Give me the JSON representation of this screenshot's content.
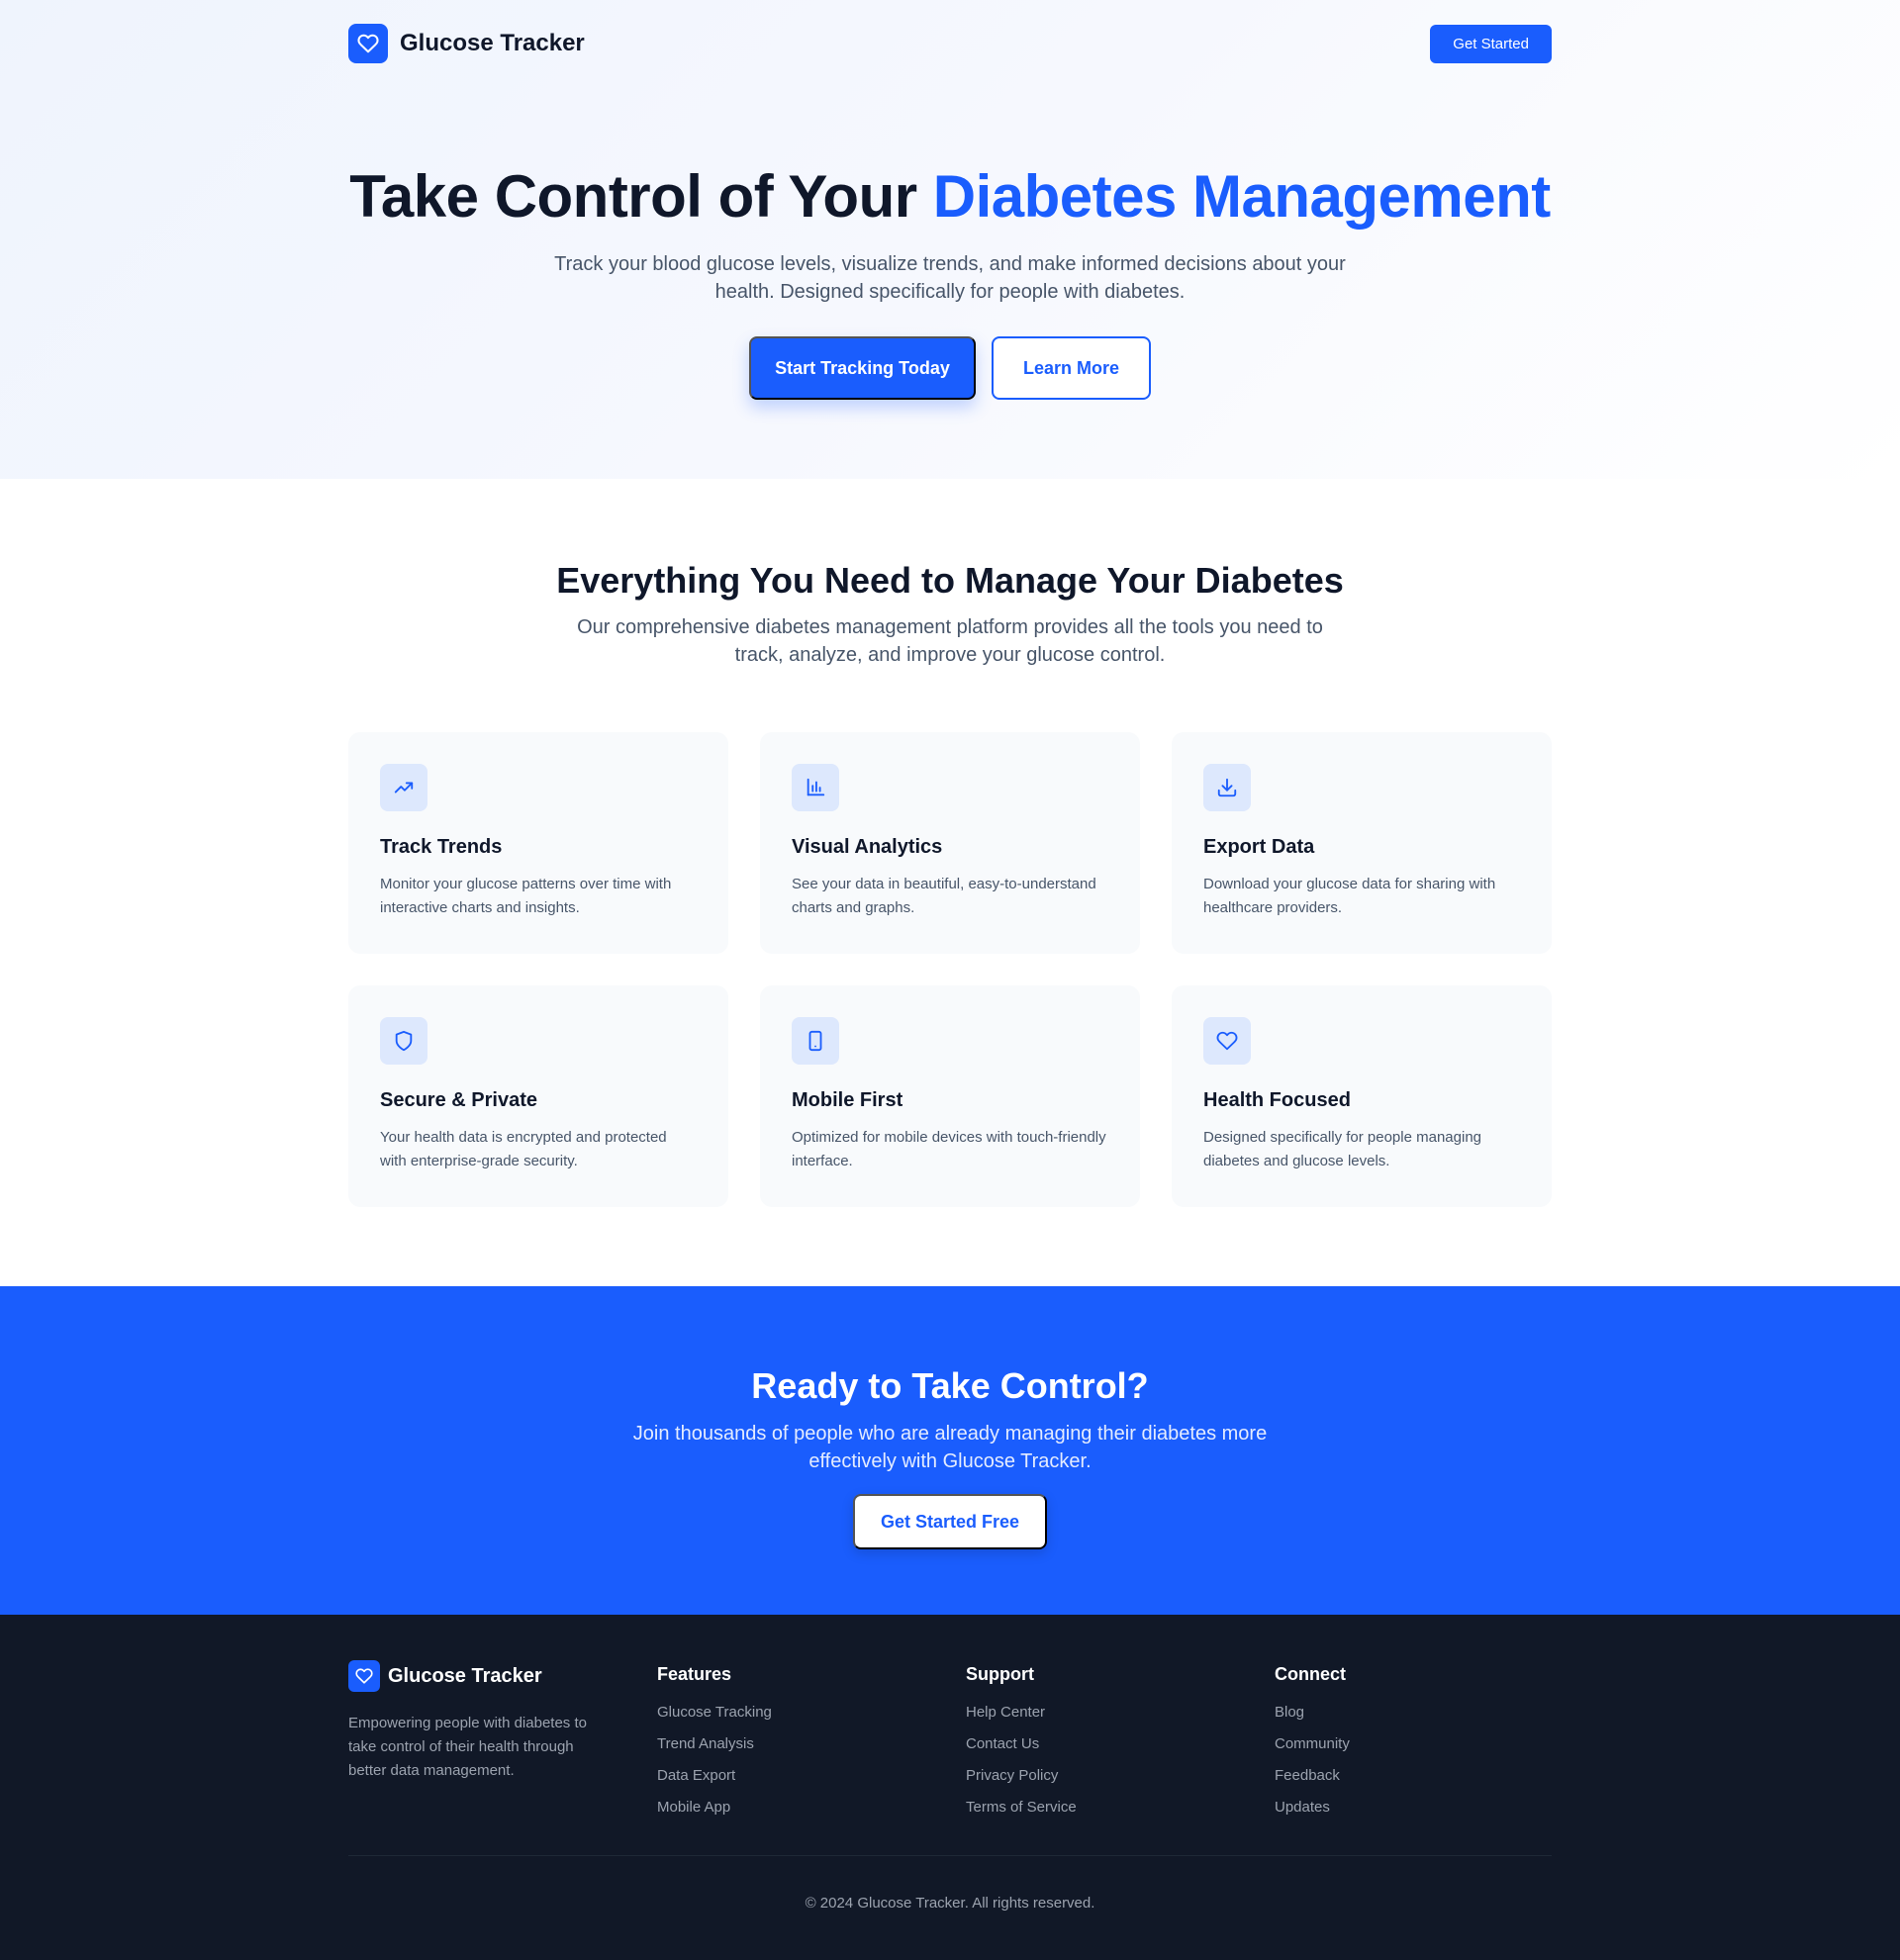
{
  "header": {
    "brand": "Glucose Tracker",
    "get_started": "Get Started"
  },
  "hero": {
    "title_part1": "Take Control of Your ",
    "title_accent": "Diabetes Management",
    "subtitle": "Track your blood glucose levels, visualize trends, and make informed decisions about your health. Designed specifically for people with diabetes.",
    "primary_cta": "Start Tracking Today",
    "secondary_cta": "Learn More"
  },
  "features": {
    "title": "Everything You Need to Manage Your Diabetes",
    "subtitle": "Our comprehensive diabetes management platform provides all the tools you need to track, analyze, and improve your glucose control.",
    "items": [
      {
        "icon": "trending-up-icon",
        "title": "Track Trends",
        "desc": "Monitor your glucose patterns over time with interactive charts and insights."
      },
      {
        "icon": "bar-chart-icon",
        "title": "Visual Analytics",
        "desc": "See your data in beautiful, easy-to-understand charts and graphs."
      },
      {
        "icon": "download-icon",
        "title": "Export Data",
        "desc": "Download your glucose data for sharing with healthcare providers."
      },
      {
        "icon": "shield-icon",
        "title": "Secure & Private",
        "desc": "Your health data is encrypted and protected with enterprise-grade security."
      },
      {
        "icon": "smartphone-icon",
        "title": "Mobile First",
        "desc": "Optimized for mobile devices with touch-friendly interface."
      },
      {
        "icon": "heart-icon",
        "title": "Health Focused",
        "desc": "Designed specifically for people managing diabetes and glucose levels."
      }
    ]
  },
  "cta": {
    "title": "Ready to Take Control?",
    "subtitle": "Join thousands of people who are already managing their diabetes more effectively with Glucose Tracker.",
    "button": "Get Started Free"
  },
  "footer": {
    "brand": "Glucose Tracker",
    "description": "Empowering people with diabetes to take control of their health through better data management.",
    "columns": [
      {
        "heading": "Features",
        "links": [
          "Glucose Tracking",
          "Trend Analysis",
          "Data Export",
          "Mobile App"
        ]
      },
      {
        "heading": "Support",
        "links": [
          "Help Center",
          "Contact Us",
          "Privacy Policy",
          "Terms of Service"
        ]
      },
      {
        "heading": "Connect",
        "links": [
          "Blog",
          "Community",
          "Feedback",
          "Updates"
        ]
      }
    ],
    "copyright": "© 2024 Glucose Tracker. All rights reserved."
  },
  "colors": {
    "accent": "#1a5dfd",
    "footer_bg": "#111827",
    "card_bg": "#f8fafc"
  }
}
